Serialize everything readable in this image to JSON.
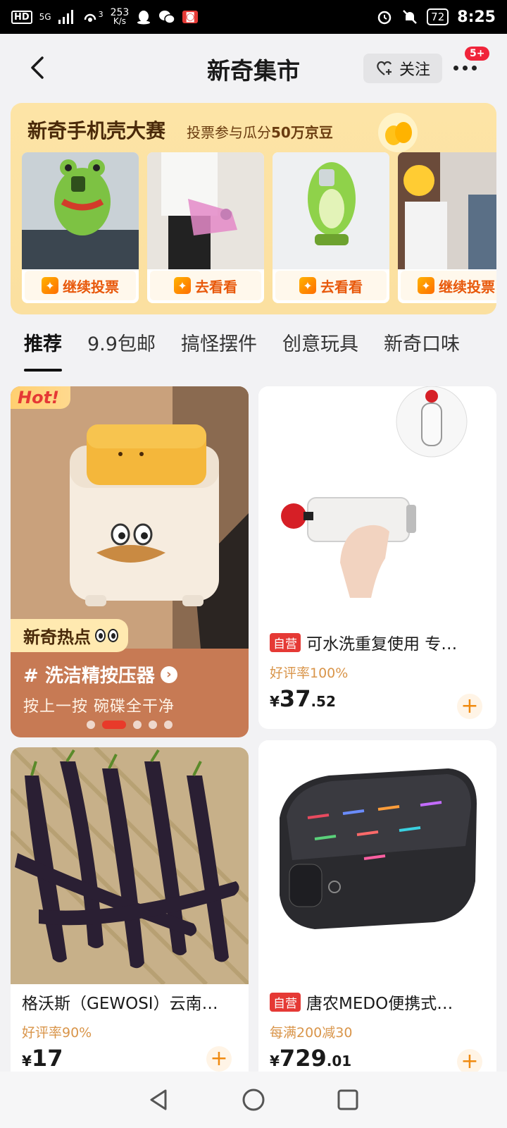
{
  "status_bar": {
    "network": "5G",
    "hd": "HD",
    "speed_value": "253",
    "speed_unit": "K/s",
    "wifi_sub": "3",
    "battery": "72",
    "time": "8:25"
  },
  "nav": {
    "title": "新奇集市",
    "follow_label": "关注",
    "badge": "5+"
  },
  "banner": {
    "title": "新奇手机壳大赛",
    "subtitle_prefix": "投票参与瓜分",
    "subtitle_highlight": "50万京豆",
    "cards": [
      {
        "button": "继续投票"
      },
      {
        "button": "去看看"
      },
      {
        "button": "去看看"
      },
      {
        "button": "继续投票"
      }
    ]
  },
  "tabs": [
    "推荐",
    "9.9包邮",
    "搞怪摆件",
    "创意玩具",
    "新奇口味"
  ],
  "hot_card": {
    "label": "Hot!",
    "tag": "新奇热点",
    "topic": "# 洗洁精按压器",
    "description": "按上一按 碗碟全干净"
  },
  "products": [
    {
      "self_run": "自营",
      "title": "可水洗重复使用 专…",
      "sub": "好评率100%",
      "currency": "¥",
      "price_int": "37",
      "price_dec": ".52"
    },
    {
      "self_run": "",
      "title": "格沃斯（GEWOSI）云南…",
      "sub": "好评率90%",
      "currency": "¥",
      "price_int": "17",
      "price_dec": ""
    },
    {
      "self_run": "自营",
      "title": "唐农MEDO便携式…",
      "sub": "每满200减30",
      "currency": "¥",
      "price_int": "729",
      "price_dec": ".01"
    }
  ],
  "colors": {
    "accent": "#f08a10",
    "badge_red": "#f0243a",
    "self_run_red": "#e53935",
    "banner_bg": "#fde4a6"
  },
  "icons": [
    "back-arrow-icon",
    "heart-plus-icon",
    "more-dots-icon",
    "nav-back-icon",
    "nav-home-icon",
    "nav-recents-icon"
  ]
}
